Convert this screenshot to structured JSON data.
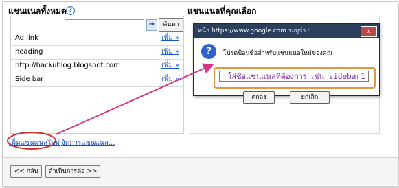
{
  "left_panel": {
    "title": "แชนแนลทั้งหมด",
    "search_button": "ค้นหา",
    "items": [
      {
        "name": "Ad link",
        "action": "เพิ่ม »"
      },
      {
        "name": "heading",
        "action": "เพิ่ม »"
      },
      {
        "name": "http://hackublog.blogspot.com",
        "action": "เพิ่ม »"
      },
      {
        "name": "Side bar",
        "action": "เพิ่ม »"
      }
    ]
  },
  "right_panel": {
    "title": "แชนแนลที่คุณเลือก"
  },
  "bottom_links": {
    "add_new": "เพิ่มแชนแนลใหม่",
    "manage": "จัดการแชนแนล..."
  },
  "footer": {
    "back_button": "<< กลับ",
    "next_button": "ดำเนินการต่อ >>"
  },
  "dialog": {
    "title": "หน้า https://www.google.com ระบุว่า :",
    "message": "โปรดป้อนชื่อสำหรับแชนแนลใหม่ของคุณ",
    "input_value": "ใส่ชื่อแชนแนลที่ต้องการ เช่น sidebar1",
    "ok_label": "ตกลง",
    "cancel_label": "ยกเลิก",
    "close_symbol": "x"
  },
  "icons": {
    "help": "help-icon",
    "question": "question-icon"
  },
  "colors": {
    "annotation_arrow": "#d63384",
    "annotation_ellipse": "#cc3333",
    "input_highlight": "#e4973d",
    "dialog_title_bg": "#2a3f5c",
    "link": "#1155cc"
  }
}
